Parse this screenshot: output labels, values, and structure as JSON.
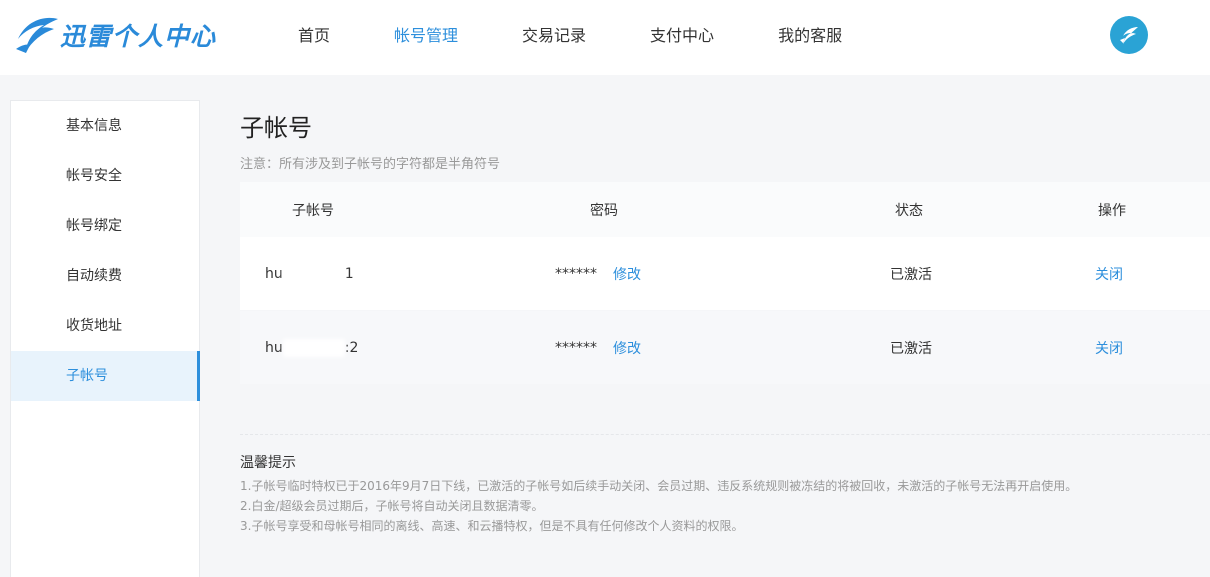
{
  "brand": {
    "logo_text": "迅雷个人中心"
  },
  "nav": {
    "items": [
      {
        "label": "首页"
      },
      {
        "label": "帐号管理"
      },
      {
        "label": "交易记录"
      },
      {
        "label": "支付中心"
      },
      {
        "label": "我的客服"
      }
    ],
    "active_index": 1
  },
  "sidebar": {
    "items": [
      {
        "label": "基本信息"
      },
      {
        "label": "帐号安全"
      },
      {
        "label": "帐号绑定"
      },
      {
        "label": "自动续费"
      },
      {
        "label": "收货地址"
      },
      {
        "label": "子帐号"
      }
    ],
    "active_index": 5
  },
  "main": {
    "title": "子帐号",
    "note": "注意：所有涉及到子帐号的字符都是半角符号",
    "table": {
      "headers": {
        "account": "子帐号",
        "password": "密码",
        "status": "状态",
        "operation": "操作"
      },
      "rows": [
        {
          "account_prefix": "hu",
          "account_suffix": "1",
          "password_mask": "******",
          "edit_label": "修改",
          "status": "已激活",
          "op_label": "关闭"
        },
        {
          "account_prefix": "hu",
          "account_suffix": ":2",
          "password_mask": "******",
          "edit_label": "修改",
          "status": "已激活",
          "op_label": "关闭"
        }
      ]
    },
    "tips": {
      "title": "温馨提示",
      "lines": [
        "1.子帐号临时特权已于2016年9月7日下线，已激活的子帐号如后续手动关闭、会员过期、违反系统规则被冻结的将被回收，未激活的子帐号无法再开启使用。",
        "2.白金/超级会员过期后，子帐号将自动关闭且数据清零。",
        "3.子帐号享受和母帐号相同的离线、高速、和云播特权，但是不具有任何修改个人资料的权限。"
      ]
    }
  },
  "colors": {
    "accent": "#2d8fdc",
    "brand": "#2a8ad9",
    "avatar_bg": "#2aa3d5"
  },
  "icons": {
    "logo": "xunlei-bird-icon",
    "avatar": "xunlei-bird-avatar-icon"
  }
}
